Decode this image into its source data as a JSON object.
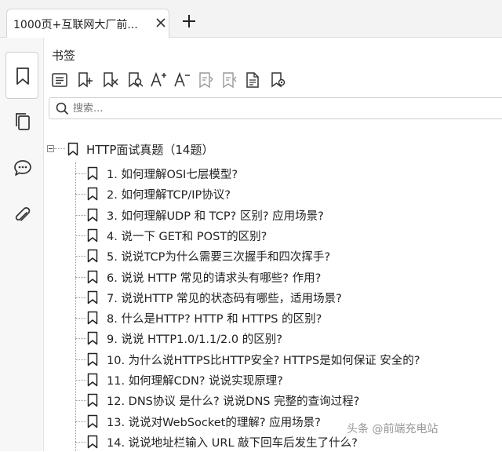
{
  "tab": {
    "title": "1000页+互联网大厂前...",
    "close": "×",
    "add": "+"
  },
  "rail": {
    "items": [
      "bookmark-icon",
      "pages-icon",
      "comments-icon",
      "attachments-icon"
    ],
    "active": "bookmark-icon"
  },
  "panel": {
    "title": "书签",
    "toolbar": [
      "expand-all-icon",
      "add-bookmark-icon",
      "delete-bookmark-icon",
      "find-bookmark-icon",
      "increase-font-icon",
      "decrease-font-icon",
      "promote-icon",
      "demote-icon",
      "bookmark-properties-icon",
      "bookmark-settings-icon"
    ]
  },
  "search": {
    "placeholder": "搜索..."
  },
  "tree": {
    "root": "HTTP面试真题（14题）",
    "items": [
      "1. 如何理解OSI七层模型?",
      "2. 如何理解TCP/IP协议?",
      "3. 如何理解UDP 和 TCP? 区别? 应用场景?",
      "4. 说一下 GET和 POST的区别?",
      "5. 说说TCP为什么需要三次握手和四次挥手?",
      "6. 说说 HTTP 常见的请求头有哪些? 作用?",
      "7. 说说HTTP 常见的状态码有哪些，适用场景?",
      "8. 什么是HTTP? HTTP 和 HTTPS 的区别?",
      "9. 说说 HTTP1.0/1.1/2.0 的区别?",
      "10. 为什么说HTTPS比HTTP安全? HTTPS是如何保证 安全的?",
      "11. 如何理解CDN? 说说实现原理?",
      "12. DNS协议 是什么? 说说DNS 完整的查询过程?",
      "13. 说说对WebSocket的理解? 应用场景?",
      "14. 说说地址栏输入 URL 敲下回车后发生了什么?"
    ]
  },
  "watermark": "头条 @前端充电站"
}
